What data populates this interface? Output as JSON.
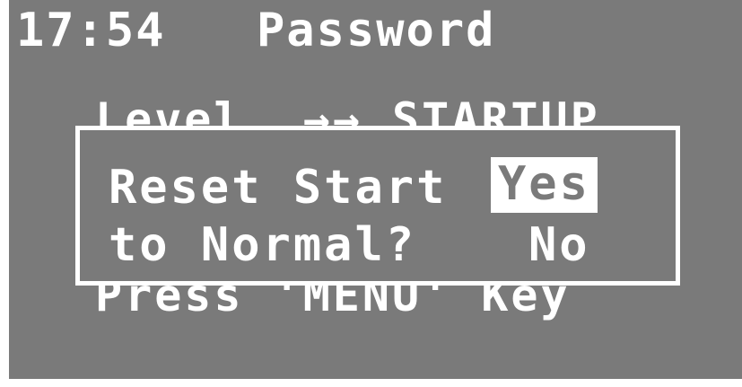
{
  "status_bar": {
    "time": "17:54",
    "title": "Password"
  },
  "background": {
    "line1": "Level  →→ STARTUP",
    "line2": "Press 'MENU' Key"
  },
  "dialog": {
    "line1": "Reset Start",
    "line2": "to Normal?",
    "options": [
      {
        "label": "Yes",
        "selected": true
      },
      {
        "label": "No",
        "selected": false
      }
    ]
  },
  "colors": {
    "screen_bg": "#7a7a7a",
    "foreground": "#ffffff"
  }
}
